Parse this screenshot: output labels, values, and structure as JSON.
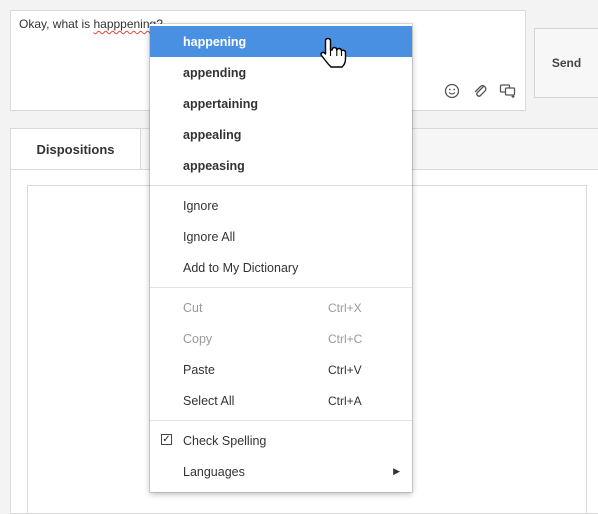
{
  "composer": {
    "text_before": "Okay, what is ",
    "misspelled_word": "happpening?",
    "send_label": "Send",
    "icons": [
      "emoji-icon",
      "attachment-icon",
      "quick-reply-icon"
    ]
  },
  "tabs": {
    "active_label": "Dispositions"
  },
  "context_menu": {
    "suggestions": [
      "happening",
      "appending",
      "appertaining",
      "appealing",
      "appeasing"
    ],
    "spell_actions": [
      "Ignore",
      "Ignore All",
      "Add to My Dictionary"
    ],
    "edit_actions": [
      {
        "label": "Cut",
        "shortcut": "Ctrl+X",
        "enabled": false
      },
      {
        "label": "Copy",
        "shortcut": "Ctrl+C",
        "enabled": false
      },
      {
        "label": "Paste",
        "shortcut": "Ctrl+V",
        "enabled": true
      },
      {
        "label": "Select All",
        "shortcut": "Ctrl+A",
        "enabled": true
      }
    ],
    "check_spelling": {
      "label": "Check Spelling",
      "checked": true
    },
    "languages_label": "Languages",
    "highlighted_index": 0
  },
  "colors": {
    "highlight": "#4a90e2",
    "misspell_underline": "#e0463c"
  }
}
